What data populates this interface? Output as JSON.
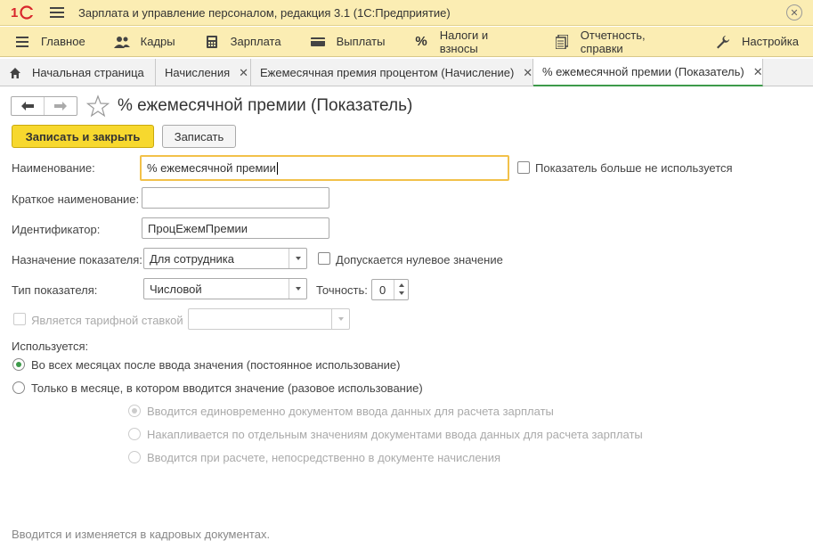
{
  "titlebar": {
    "logo": "1C",
    "title": "Зарплата и управление персоналом, редакция 3.1  (1С:Предприятие)"
  },
  "menu": [
    {
      "label": "Главное",
      "icon": "hamburger-icon"
    },
    {
      "label": "Кадры",
      "icon": "people-icon"
    },
    {
      "label": "Зарплата",
      "icon": "calculator-icon"
    },
    {
      "label": "Выплаты",
      "icon": "wallet-icon"
    },
    {
      "label": "Налоги и взносы",
      "icon": "percent-icon"
    },
    {
      "label": "Отчетность, справки",
      "icon": "reports-icon"
    },
    {
      "label": "Настройка",
      "icon": "wrench-icon"
    }
  ],
  "tabs": [
    {
      "label": "Начальная страница",
      "closable": false
    },
    {
      "label": "Начисления",
      "closable": true
    },
    {
      "label": "Ежемесячная премия процентом (Начисление)",
      "closable": true
    },
    {
      "label": "% ежемесячной премии (Показатель)",
      "closable": true,
      "active": true
    }
  ],
  "form": {
    "title": "% ежемесячной премии (Показатель)",
    "save_close_label": "Записать и закрыть",
    "save_label": "Записать",
    "name_label": "Наименование:",
    "name_value": "% ежемесячной премии",
    "not_used_label": "Показатель больше не используется",
    "short_name_label": "Краткое наименование:",
    "short_name_value": "",
    "id_label": "Идентификатор:",
    "id_value": "ПроцЕжемПремии",
    "purpose_label": "Назначение показателя:",
    "purpose_value": "Для сотрудника",
    "zero_allowed_label": "Допускается нулевое значение",
    "type_label": "Тип показателя:",
    "type_value": "Числовой",
    "precision_label": "Точность:",
    "precision_value": "0",
    "tariff_label": "Является тарифной ставкой",
    "used_label": "Используется:",
    "radio_permanent": "Во всех месяцах после ввода значения (постоянное использование)",
    "radio_once": "Только в месяце, в котором вводится значение (разовое использование)",
    "sub_radio_1": "Вводится единовременно документом ввода данных для расчета зарплаты",
    "sub_radio_2": "Накапливается по отдельным значениям документами ввода данных для расчета зарплаты",
    "sub_radio_3": "Вводится при расчете, непосредственно в документе начисления",
    "footnote": "Вводится и изменяется в кадровых документах."
  },
  "colors": {
    "header_bg": "#fbedb3",
    "primary_button": "#f7d82e",
    "active_tab_underline": "#3d9a4a",
    "focus_border": "#f2c14a"
  }
}
